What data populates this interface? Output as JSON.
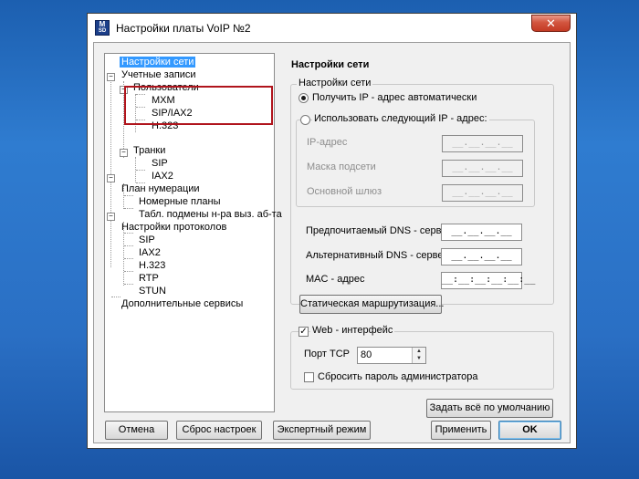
{
  "window": {
    "title": "Настройки платы VoIP №2",
    "icon_text_top": "M",
    "icon_text_bottom": "SD",
    "close_glyph": "✕"
  },
  "tree": {
    "items": [
      {
        "label": "Настройки сети",
        "selected": true
      },
      {
        "label": "Учетные записи"
      },
      {
        "label": "Пользователи"
      },
      {
        "label": "MXM"
      },
      {
        "label": "SIP/IAX2"
      },
      {
        "label": "H.323"
      },
      {
        "label": "Транки"
      },
      {
        "label": "SIP"
      },
      {
        "label": "IAX2"
      },
      {
        "label": "План нумерации"
      },
      {
        "label": "Номерные планы"
      },
      {
        "label": "Табл. подмены н-ра выз. аб-та"
      },
      {
        "label": "Настройки протоколов"
      },
      {
        "label": "SIP"
      },
      {
        "label": "IAX2"
      },
      {
        "label": "H.323"
      },
      {
        "label": "RTP"
      },
      {
        "label": "STUN"
      },
      {
        "label": "Дополнительные сервисы"
      }
    ],
    "expander_glyph": "−"
  },
  "panel": {
    "title": "Настройки сети",
    "network_group": "Настройки сети",
    "radio_auto": "Получить IP - адрес автоматически",
    "radio_manual": "Использовать следующий IP - адрес:",
    "ip_label": "IP-адрес",
    "mask_label": "Маска подсети",
    "gateway_label": "Основной шлюз",
    "ip_value": "__.__.__.__",
    "mask_value": "__.__.__.__",
    "gateway_value": "__.__.__.__",
    "dns1_label": "Предпочитаемый DNS - сервер",
    "dns2_label": "Альтернативный DNS - сервер",
    "mac_label": "MAC - адрес",
    "dns1_value": "__.__.__.__",
    "dns2_value": "__.__.__.__",
    "mac_value": "__:__:__:__:__:__",
    "static_routing_button": "Статическая маршрутизация...",
    "web_label": "Web - интерфейс",
    "web_checked": true,
    "port_label": "Порт TCP",
    "port_value": "80",
    "reset_password_label": "Сбросить пароль администратора",
    "reset_password_checked": false,
    "defaults_button": "Задать всё по умолчанию"
  },
  "buttons": {
    "cancel": "Отмена",
    "reset": "Сброс настроек",
    "expert": "Экспертный режим",
    "apply": "Применить",
    "ok": "OK"
  },
  "colors": {
    "background": "#2a6fc4",
    "selection": "#3399ff",
    "highlight_box": "#b0141c",
    "close_button": "#c43a23"
  }
}
